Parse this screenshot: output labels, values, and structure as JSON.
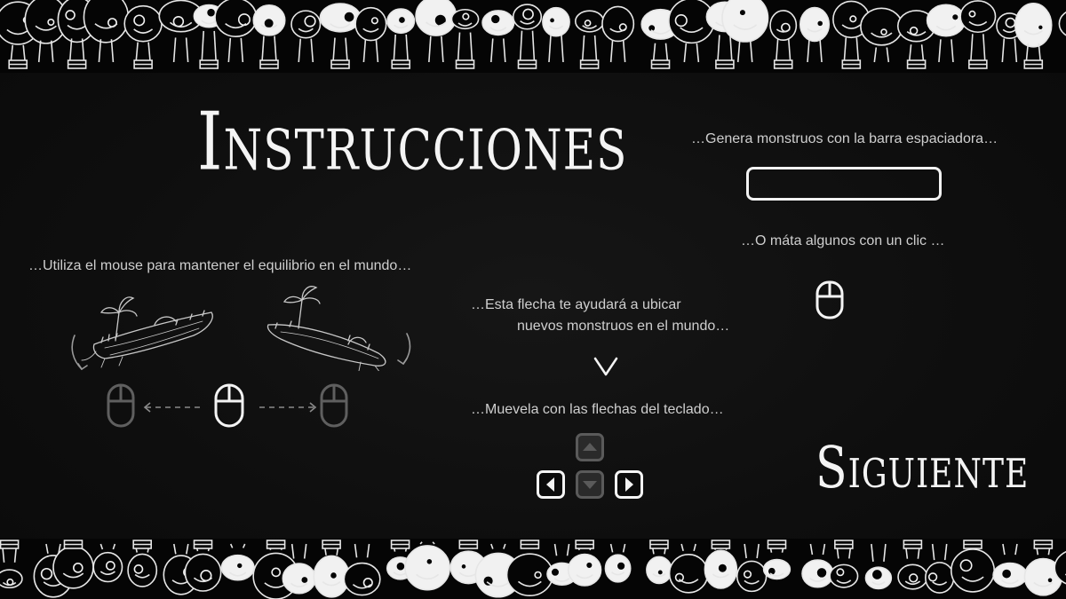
{
  "title": "Instrucciones",
  "next_label": "Siguiente",
  "instructions": {
    "mouse_balance": "…Utiliza el mouse para mantener el equilibrio en el mundo…",
    "arrow_line1": "…Esta flecha te ayudará a ubicar",
    "arrow_line2": "nuevos monstruos en el mundo…",
    "keys_move": "…Muevela con las flechas del teclado…",
    "spawn": "…Genera monstruos con la barra espaciadora…",
    "kill": "…O máta algunos con un clic …"
  },
  "icons": {
    "mouse": "mouse-icon",
    "island": "island-icon",
    "chevron": "chevron-down-icon",
    "arrow_up": "arrow-up-icon",
    "arrow_down": "arrow-down-icon",
    "arrow_left": "arrow-left-icon",
    "arrow_right": "arrow-right-icon"
  },
  "colors": {
    "background": "#0e0e0e",
    "foreground": "#f4f4f4",
    "dim": "#5a5a5a"
  }
}
